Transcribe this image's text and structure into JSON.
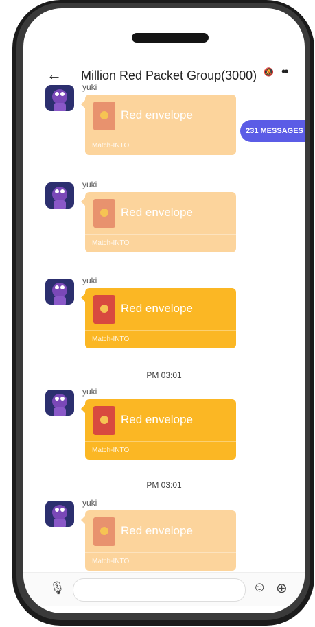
{
  "header": {
    "back_icon": "back-arrow-icon",
    "title": "Million Red Packet Group(3000)",
    "mute_icon": "mute-bell-icon",
    "more_icon": "more-dots-icon"
  },
  "badge": {
    "label": "231 MESSAGES",
    "color": "#5b5ce6"
  },
  "messages": [
    {
      "sender": "yuki",
      "label": "Red envelope",
      "footer": "Match-INTO",
      "state": "read"
    },
    {
      "sender": "yuki",
      "label": "Red envelope",
      "footer": "Match-INTO",
      "state": "read"
    },
    {
      "sender": "yuki",
      "label": "Red envelope",
      "footer": "Match-INTO",
      "state": "unread"
    },
    {
      "sender": "yuki",
      "label": "Red envelope",
      "footer": "Match-INTO",
      "state": "unread"
    },
    {
      "sender": "yuki",
      "label": "Red envelope",
      "footer": "Match-INTO",
      "state": "read"
    }
  ],
  "timestamps": [
    "PM 03:01",
    "PM 03:01"
  ],
  "input": {
    "mic_icon": "microphone-icon",
    "placeholder": "",
    "emoji_icon": "smiley-icon",
    "add_icon": "plus-circle-icon"
  },
  "colors": {
    "envelope_read": "#fcd49c",
    "envelope_unread": "#fbb724"
  }
}
